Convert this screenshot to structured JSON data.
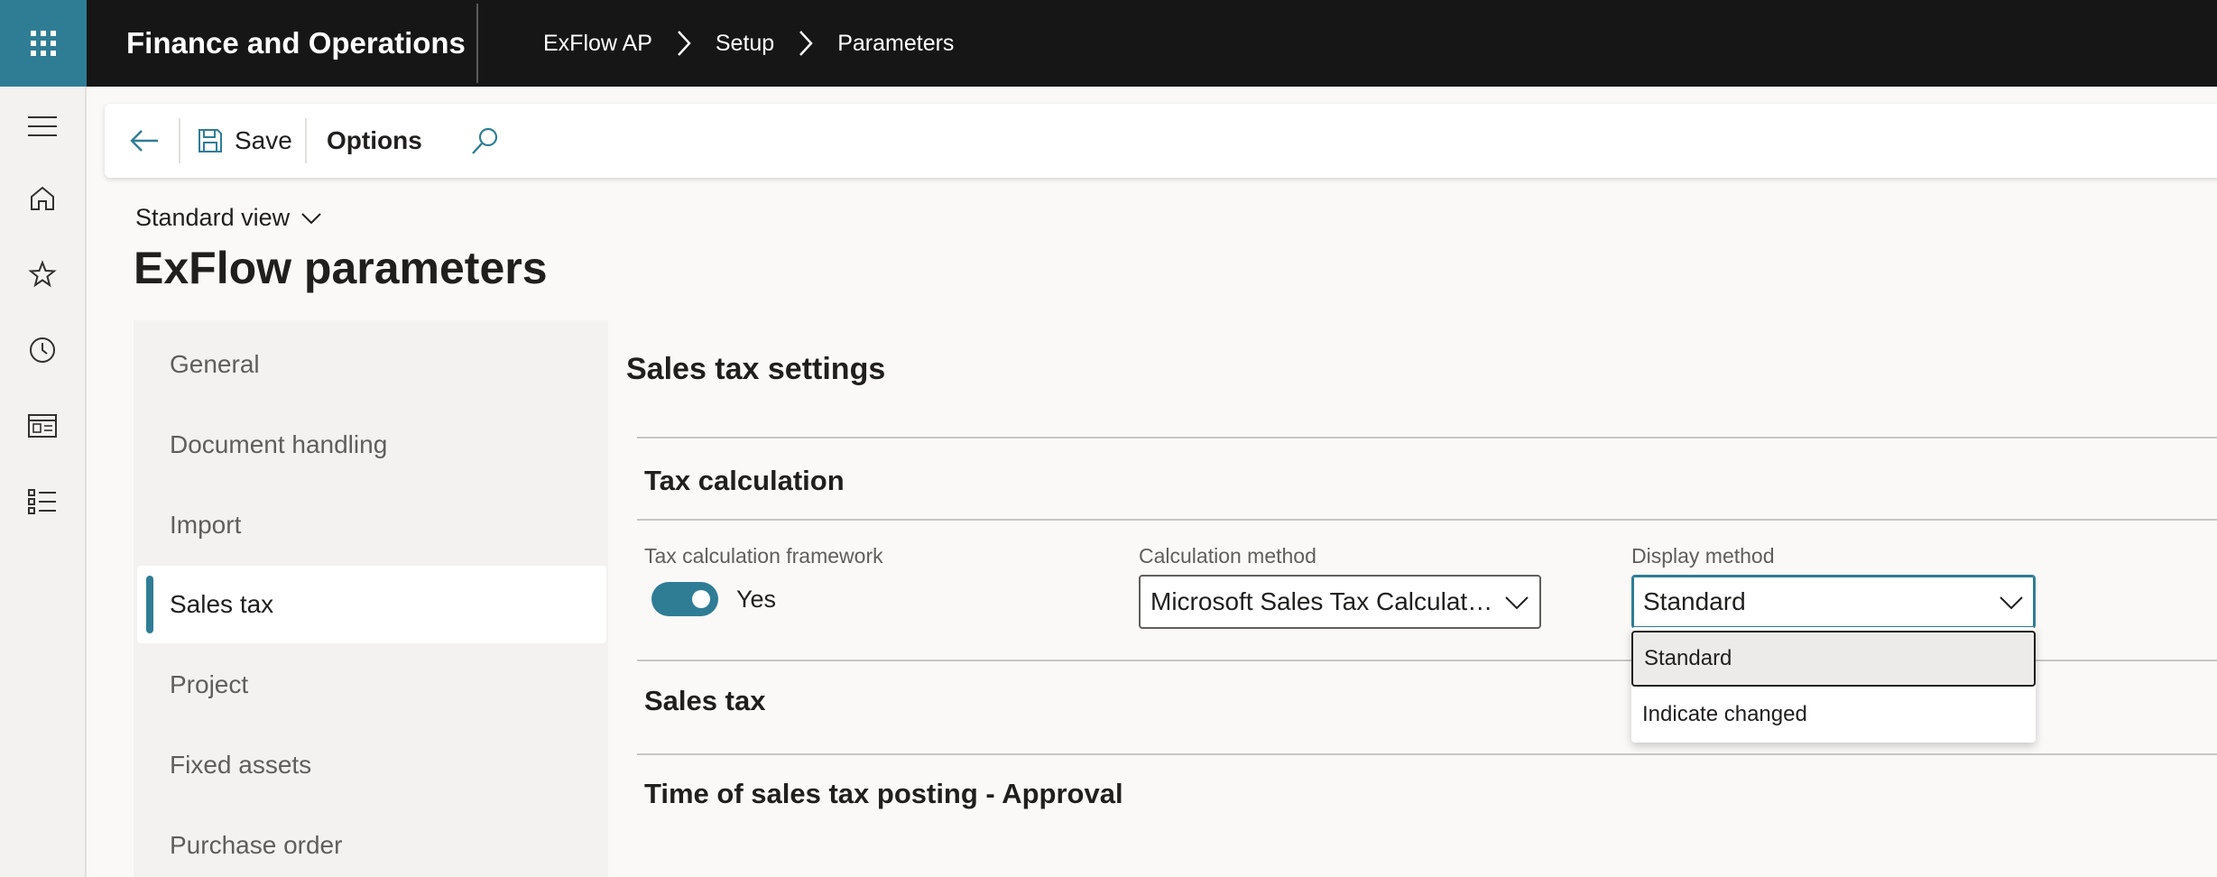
{
  "topbar": {
    "app_title": "Finance and Operations",
    "breadcrumbs": [
      "ExFlow AP",
      "Setup",
      "Parameters"
    ]
  },
  "rail": {
    "items": [
      "hamburger-icon",
      "home-icon",
      "star-icon",
      "clock-icon",
      "workspace-icon",
      "list-icon"
    ]
  },
  "actionbar": {
    "save_label": "Save",
    "options_label": "Options"
  },
  "header": {
    "view_label": "Standard view",
    "page_title": "ExFlow parameters"
  },
  "nav": {
    "items": [
      {
        "label": "General"
      },
      {
        "label": "Document handling"
      },
      {
        "label": "Import"
      },
      {
        "label": "Sales tax",
        "active": true
      },
      {
        "label": "Project"
      },
      {
        "label": "Fixed assets"
      },
      {
        "label": "Purchase order"
      }
    ]
  },
  "content": {
    "section_title": "Sales tax settings",
    "tax_calc": {
      "title": "Tax calculation",
      "framework_label": "Tax calculation framework",
      "framework_value": "Yes",
      "calc_method_label": "Calculation method",
      "calc_method_value": "Microsoft Sales Tax Calculatio...",
      "display_method_label": "Display method",
      "display_method_value": "Standard"
    },
    "sales_tax_title": "Sales tax",
    "posting_title": "Time of sales tax posting - Approval"
  },
  "dropdown": {
    "options": [
      "Standard",
      "Indicate changed"
    ],
    "selected": "Standard"
  },
  "colors": {
    "accent": "#2f7d95",
    "topbar": "#161616"
  }
}
